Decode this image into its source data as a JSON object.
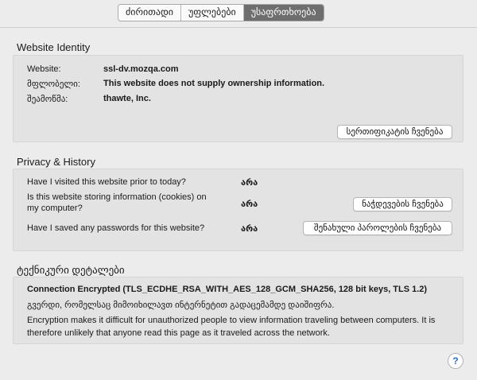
{
  "tabs": [
    {
      "label": "ძირითადი",
      "active": false
    },
    {
      "label": "უფლებები",
      "active": false
    },
    {
      "label": "უსაფრთხოება",
      "active": true
    }
  ],
  "identity": {
    "title": "Website Identity",
    "website_label": "Website:",
    "website_value": "ssl-dv.mozqa.com",
    "owner_label": "მფლობელი:",
    "owner_value": "This website does not supply ownership information.",
    "verifier_label": "შეამოწმა:",
    "verifier_value": "thawte, Inc.",
    "view_cert_button": "სერთიფიკატის ჩვენება"
  },
  "privacy": {
    "title": "Privacy & History",
    "q1": "Have I visited this website prior to today?",
    "a1": "არა",
    "q2_line1": "Is this website storing information (cookies) on",
    "q2_line2": "my computer?",
    "a2": "არა",
    "cookies_button": "ნაჭდევების ჩვენება",
    "q3": "Have I saved any passwords for this website?",
    "a3": "არა",
    "passwords_button": "შენახული პაროლების ჩვენება"
  },
  "technical": {
    "title": "ტექნიკური დეტალები",
    "headline": "Connection Encrypted (TLS_ECDHE_RSA_WITH_AES_128_GCM_SHA256, 128 bit keys, TLS 1.2)",
    "line1": "გვერდი, რომელსაც მიმოიხილავთ ინტერნეტით გადაცემამდე დაიშიფრა.",
    "line2": "Encryption makes it difficult for unauthorized people to view information traveling between computers. It is therefore unlikely that anyone read this page as it traveled across the network."
  },
  "help": {
    "label": "?"
  },
  "colors": {
    "active_tab": "#6e6e6e",
    "box_bg": "#e3e3e3",
    "window_bg": "#ececec",
    "help_accent": "#2a6fd8"
  }
}
